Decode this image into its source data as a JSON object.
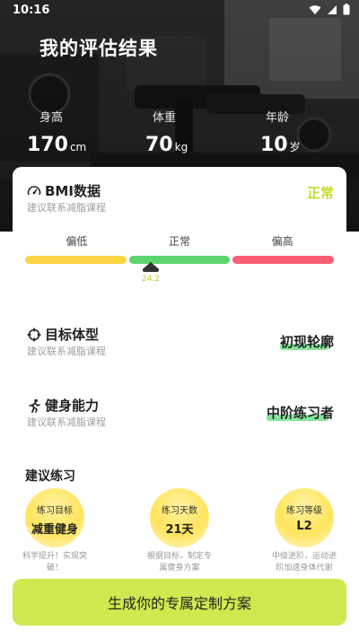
{
  "status_bar": {
    "time": "10:16"
  },
  "header": {
    "title": "我的评估结果",
    "stats": [
      {
        "label": "身高",
        "value": "170",
        "unit": "cm"
      },
      {
        "label": "体重",
        "value": "70",
        "unit": "kg"
      },
      {
        "label": "年龄",
        "value": "10",
        "unit": "岁"
      }
    ]
  },
  "bmi": {
    "title": "BMI数据",
    "subtitle": "建议联系减脂课程",
    "status": "正常",
    "status_color": "#c6dc2b",
    "segments": [
      {
        "label": "偏低",
        "color": "#fcd444"
      },
      {
        "label": "正常",
        "color": "#5cd56f"
      },
      {
        "label": "偏高",
        "color": "#fb5f77"
      }
    ],
    "value": "24.2"
  },
  "target_body": {
    "title": "目标体型",
    "subtitle": "建议联系减脂课程",
    "value": "初现轮廓"
  },
  "fitness_ability": {
    "title": "健身能力",
    "subtitle": "建议联系减脂课程",
    "value": "中阶练习者"
  },
  "exercise": {
    "title": "建议练习",
    "items": [
      {
        "label": "练习目标",
        "value": "减重健身",
        "desc": "科学提升！实现突破！"
      },
      {
        "label": "练习天数",
        "value": "21天",
        "desc": "根据目标，制定专属健身方案"
      },
      {
        "label": "练习等级",
        "value": "L2",
        "desc": "中级进阶，运动进阶加速身体代谢"
      }
    ]
  },
  "cta": {
    "label": "生成你的专属定制方案"
  },
  "icons": {
    "bmi": "speedometer-icon",
    "target": "crosshair-icon",
    "fitness": "running-person-icon"
  },
  "accent_color": "#cfe94f"
}
